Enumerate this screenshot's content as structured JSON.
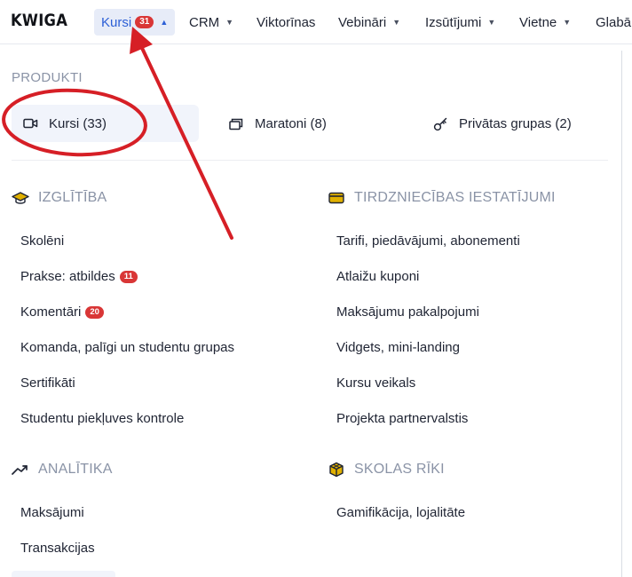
{
  "brand": {
    "logo": "KWIGA"
  },
  "nav": {
    "items": [
      {
        "label": "Kursi",
        "badge": "31",
        "chevron": "chevron-up-icon",
        "active": true
      },
      {
        "label": "CRM",
        "chevron": "chevron-down-icon"
      },
      {
        "label": "Viktorīnas"
      },
      {
        "label": "Vebināri",
        "chevron": "chevron-down-icon"
      },
      {
        "label": "Izsūtījumi",
        "chevron": "chevron-down-icon"
      },
      {
        "label": "Vietne",
        "chevron": "chevron-down-icon"
      },
      {
        "label": "Glabā"
      }
    ]
  },
  "products": {
    "label": "PRODUKTI",
    "tabs": [
      {
        "label": "Kursi (33)",
        "icon": "video-camera-icon",
        "selected": true
      },
      {
        "label": "Maratoni (8)",
        "icon": "cards-stack-icon"
      },
      {
        "label": "Privātas grupas (2)",
        "icon": "key-icon"
      }
    ]
  },
  "groups": {
    "education": {
      "title": "IZGLĪTĪBA",
      "icon": "graduation-cap-icon",
      "links": [
        {
          "label": "Skolēni"
        },
        {
          "label": "Prakse: atbildes",
          "badge": "11"
        },
        {
          "label": "Komentāri",
          "badge": "20"
        },
        {
          "label": "Komanda, palīgi un studentu grupas"
        },
        {
          "label": "Sertifikāti"
        },
        {
          "label": "Studentu piekļuves kontrole"
        }
      ]
    },
    "sales": {
      "title": "TIRDZNIECĪBAS IESTATĪJUMI",
      "icon": "credit-card-icon",
      "links": [
        {
          "label": "Tarifi, piedāvājumi, abonementi"
        },
        {
          "label": "Atlaižu kuponi"
        },
        {
          "label": "Maksājumu pakalpojumi"
        },
        {
          "label": "Vidgets, mini-landing"
        },
        {
          "label": "Kursu veikals"
        },
        {
          "label": "Projekta partnervalstis"
        }
      ]
    },
    "analytics": {
      "title": "ANALĪTIKA",
      "icon": "trend-up-icon",
      "links": [
        {
          "label": "Maksājumi"
        },
        {
          "label": "Transakcijas"
        }
      ]
    },
    "tools": {
      "title": "SKOLAS RĪKI",
      "icon": "cube-icon",
      "links": [
        {
          "label": "Gamifikācija, lojalitāte"
        }
      ]
    }
  },
  "colors": {
    "accent": "#2c5fd6",
    "active_bg": "#e7ecf8",
    "badge": "#d93636",
    "muted": "#8a93a6",
    "annotation": "#d61f26",
    "icon_gold": "#e0b000"
  }
}
